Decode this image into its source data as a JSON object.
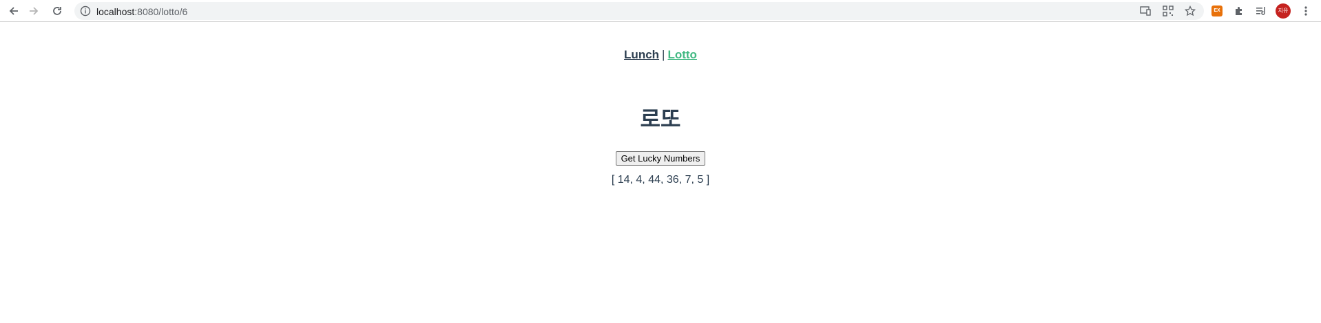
{
  "browser": {
    "url_host": "localhost",
    "url_path": ":8080/lotto/6",
    "profile_initials": "지유",
    "extension_badge": "EX",
    "colors": {
      "profile": "#c5221f",
      "extension": "#e8710a"
    }
  },
  "nav": {
    "lunch_label": "Lunch",
    "separator": "|",
    "lotto_label": "Lotto"
  },
  "main": {
    "title": "로또",
    "button_label": "Get Lucky Numbers",
    "result": "[ 14, 4, 44, 36, 7, 5 ]"
  },
  "colors": {
    "text": "#2c3e50",
    "active_link": "#42b983"
  }
}
